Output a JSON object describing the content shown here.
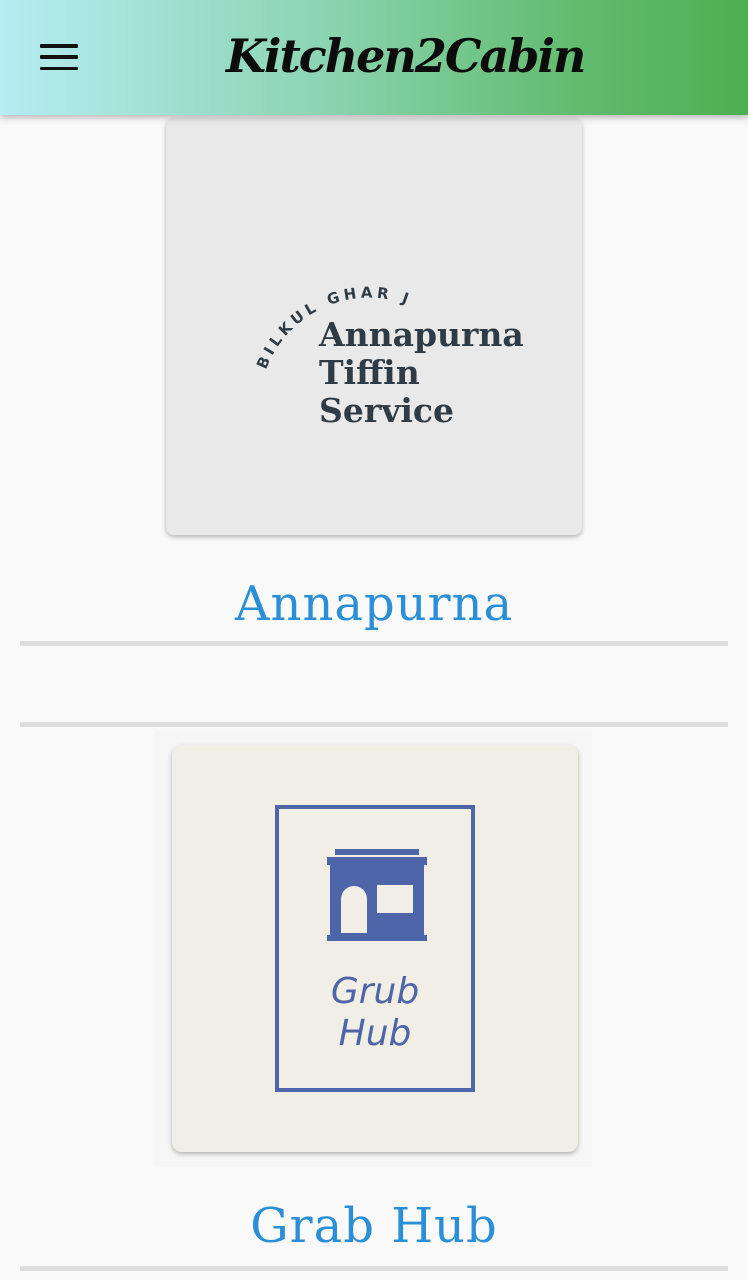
{
  "app": {
    "title": "Kitchen2Cabin",
    "menu_icon": "hamburger-menu-icon",
    "header_gradient": [
      "#b6ecf2",
      "#4caf50"
    ]
  },
  "items": [
    {
      "name": "Annapurna",
      "logo": {
        "tagline": "BILKUL GHAR JAISA!",
        "line1": "Annapurna",
        "line2": "Tiffin",
        "line3": "Service"
      }
    },
    {
      "name": "Grab Hub",
      "logo": {
        "icon": "storefront-icon",
        "line1": "Grub",
        "line2": "Hub"
      }
    }
  ],
  "colors": {
    "label": "#2b8fd8",
    "grub_blue": "#4e66a9",
    "tiffin_text": "#2f3b45"
  }
}
